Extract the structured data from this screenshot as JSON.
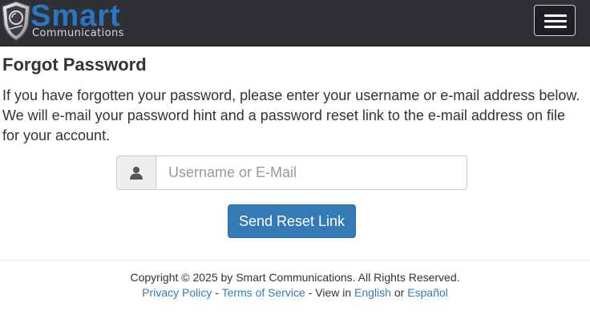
{
  "header": {
    "brand_name": "Smart",
    "brand_subtitle": "Communications",
    "menu_icon": "hamburger-menu-icon",
    "logo_icon": "shield-logo-icon",
    "navbar_color": "#2f3033",
    "brand_color": "#2876c4"
  },
  "main": {
    "title": "Forgot Password",
    "instructions": "If you have forgotten your password, please enter your username or e-mail address below. We will e-mail your password hint and a password reset link to the e-mail address on file for your account.",
    "username_input": {
      "placeholder": "Username or E-Mail",
      "value": "",
      "icon": "user-icon"
    },
    "submit_label": "Send Reset Link",
    "primary_color": "#337ab7"
  },
  "footer": {
    "copyright": "Copyright © 2025 by Smart Communications. All Rights Reserved.",
    "privacy_link": "Privacy Policy",
    "separator_1": " - ",
    "terms_link": "Terms of Service",
    "separator_2": " - View in ",
    "english_link": "English",
    "or_text": " or ",
    "spanish_link": "Español",
    "link_color": "#337ab7"
  }
}
